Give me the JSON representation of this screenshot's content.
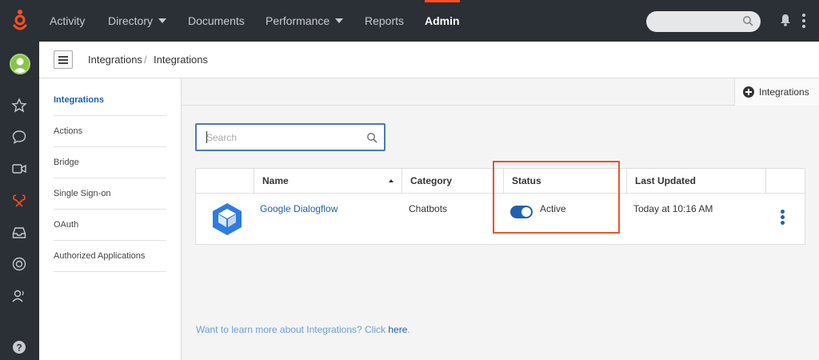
{
  "nav": {
    "items": [
      {
        "label": "Activity",
        "dropdown": false,
        "active": false
      },
      {
        "label": "Directory",
        "dropdown": true,
        "active": false
      },
      {
        "label": "Documents",
        "dropdown": false,
        "active": false
      },
      {
        "label": "Performance",
        "dropdown": true,
        "active": false
      },
      {
        "label": "Reports",
        "dropdown": false,
        "active": false
      },
      {
        "label": "Admin",
        "dropdown": false,
        "active": true
      }
    ],
    "search_placeholder": "",
    "accent_color": "#ff4f1f"
  },
  "rail": {
    "icons": [
      "avatar",
      "star-icon",
      "chat-icon",
      "video-icon",
      "integrations-icon",
      "inbox-icon",
      "help-lifebuoy-icon",
      "user-voice-icon",
      "help-icon"
    ]
  },
  "breadcrumb": [
    "Integrations",
    "Integrations"
  ],
  "breadcrumb_separator": "/",
  "subnav": {
    "items": [
      {
        "label": "Integrations",
        "active": true
      },
      {
        "label": "Actions",
        "active": false
      },
      {
        "label": "Bridge",
        "active": false
      },
      {
        "label": "Single Sign-on",
        "active": false
      },
      {
        "label": "OAuth",
        "active": false
      },
      {
        "label": "Authorized Applications",
        "active": false
      }
    ]
  },
  "toolbar": {
    "add_label": "Integrations"
  },
  "search": {
    "placeholder": "Search",
    "value": ""
  },
  "table": {
    "columns": [
      "Name",
      "Category",
      "Status",
      "Last Updated"
    ],
    "rows": [
      {
        "name": "Google Dialogflow",
        "category": "Chatbots",
        "status": "Active",
        "status_on": true,
        "last_updated": "Today at 10:16 AM",
        "icon": "dialogflow-icon"
      }
    ]
  },
  "footer": {
    "text": "Want to learn more about Integrations? Click ",
    "link": "here",
    "suffix": "."
  },
  "colors": {
    "topbar": "#2b2f36",
    "link": "#1d5fa8",
    "toggle": "#1f61b0",
    "highlight": "#e8552a"
  }
}
